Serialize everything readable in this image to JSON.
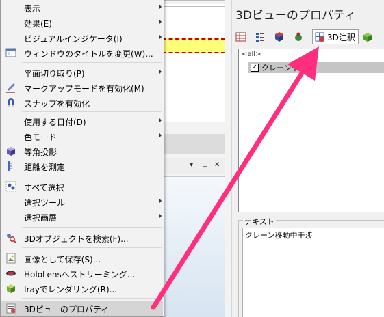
{
  "menu": {
    "items": [
      {
        "label": "表示",
        "icon": "",
        "submenu": true
      },
      {
        "label": "効果(E)",
        "icon": "",
        "submenu": true
      },
      {
        "label": "ビジュアルインジケータ(I)",
        "icon": "",
        "submenu": true
      },
      {
        "label": "ウィンドウのタイトルを変更(W)...",
        "icon": "window-title-icon",
        "submenu": false
      },
      {
        "label": "平面切り取り(P)",
        "icon": "",
        "submenu": true
      },
      {
        "label": "マークアップモードを有効化(M)",
        "icon": "pencil-icon",
        "submenu": false
      },
      {
        "label": "スナップを有効化",
        "icon": "magnet-icon",
        "submenu": false
      },
      {
        "label": "使用する日付(D)",
        "icon": "",
        "submenu": true
      },
      {
        "label": "色モード",
        "icon": "",
        "submenu": true
      },
      {
        "label": "等角投影",
        "icon": "cube-icon",
        "submenu": false
      },
      {
        "label": "距離を測定",
        "icon": "ruler-icon",
        "submenu": false
      },
      {
        "label": "すべて選択",
        "icon": "select-all-icon",
        "submenu": false
      },
      {
        "label": "選択ツール",
        "icon": "",
        "submenu": true
      },
      {
        "label": "選択画層",
        "icon": "",
        "submenu": true
      },
      {
        "label": "3Dオブジェクトを検索(F)...",
        "icon": "search-objects-icon",
        "submenu": false
      },
      {
        "label": "画像として保存(S)...",
        "icon": "save-image-icon",
        "submenu": false
      },
      {
        "label": "HoloLensへストリーミング...",
        "icon": "hololens-icon",
        "submenu": false
      },
      {
        "label": "Irayでレンダリング(R)...",
        "icon": "iray-icon",
        "submenu": false
      },
      {
        "label": "3Dビューのプロパティ",
        "icon": "properties-icon",
        "submenu": false
      }
    ]
  },
  "properties": {
    "title": "3Dビューのプロパティ",
    "active_tab": "3D注釈",
    "list_header": "<all>",
    "list_item": "クレーン干",
    "text_group_label": "テキスト",
    "text_value": "クレーン移動中干渉"
  },
  "colors": {
    "arrow": "#ff2f7d",
    "highlight_yellow": "#ffff7a",
    "dashed_red": "#cc0000"
  }
}
